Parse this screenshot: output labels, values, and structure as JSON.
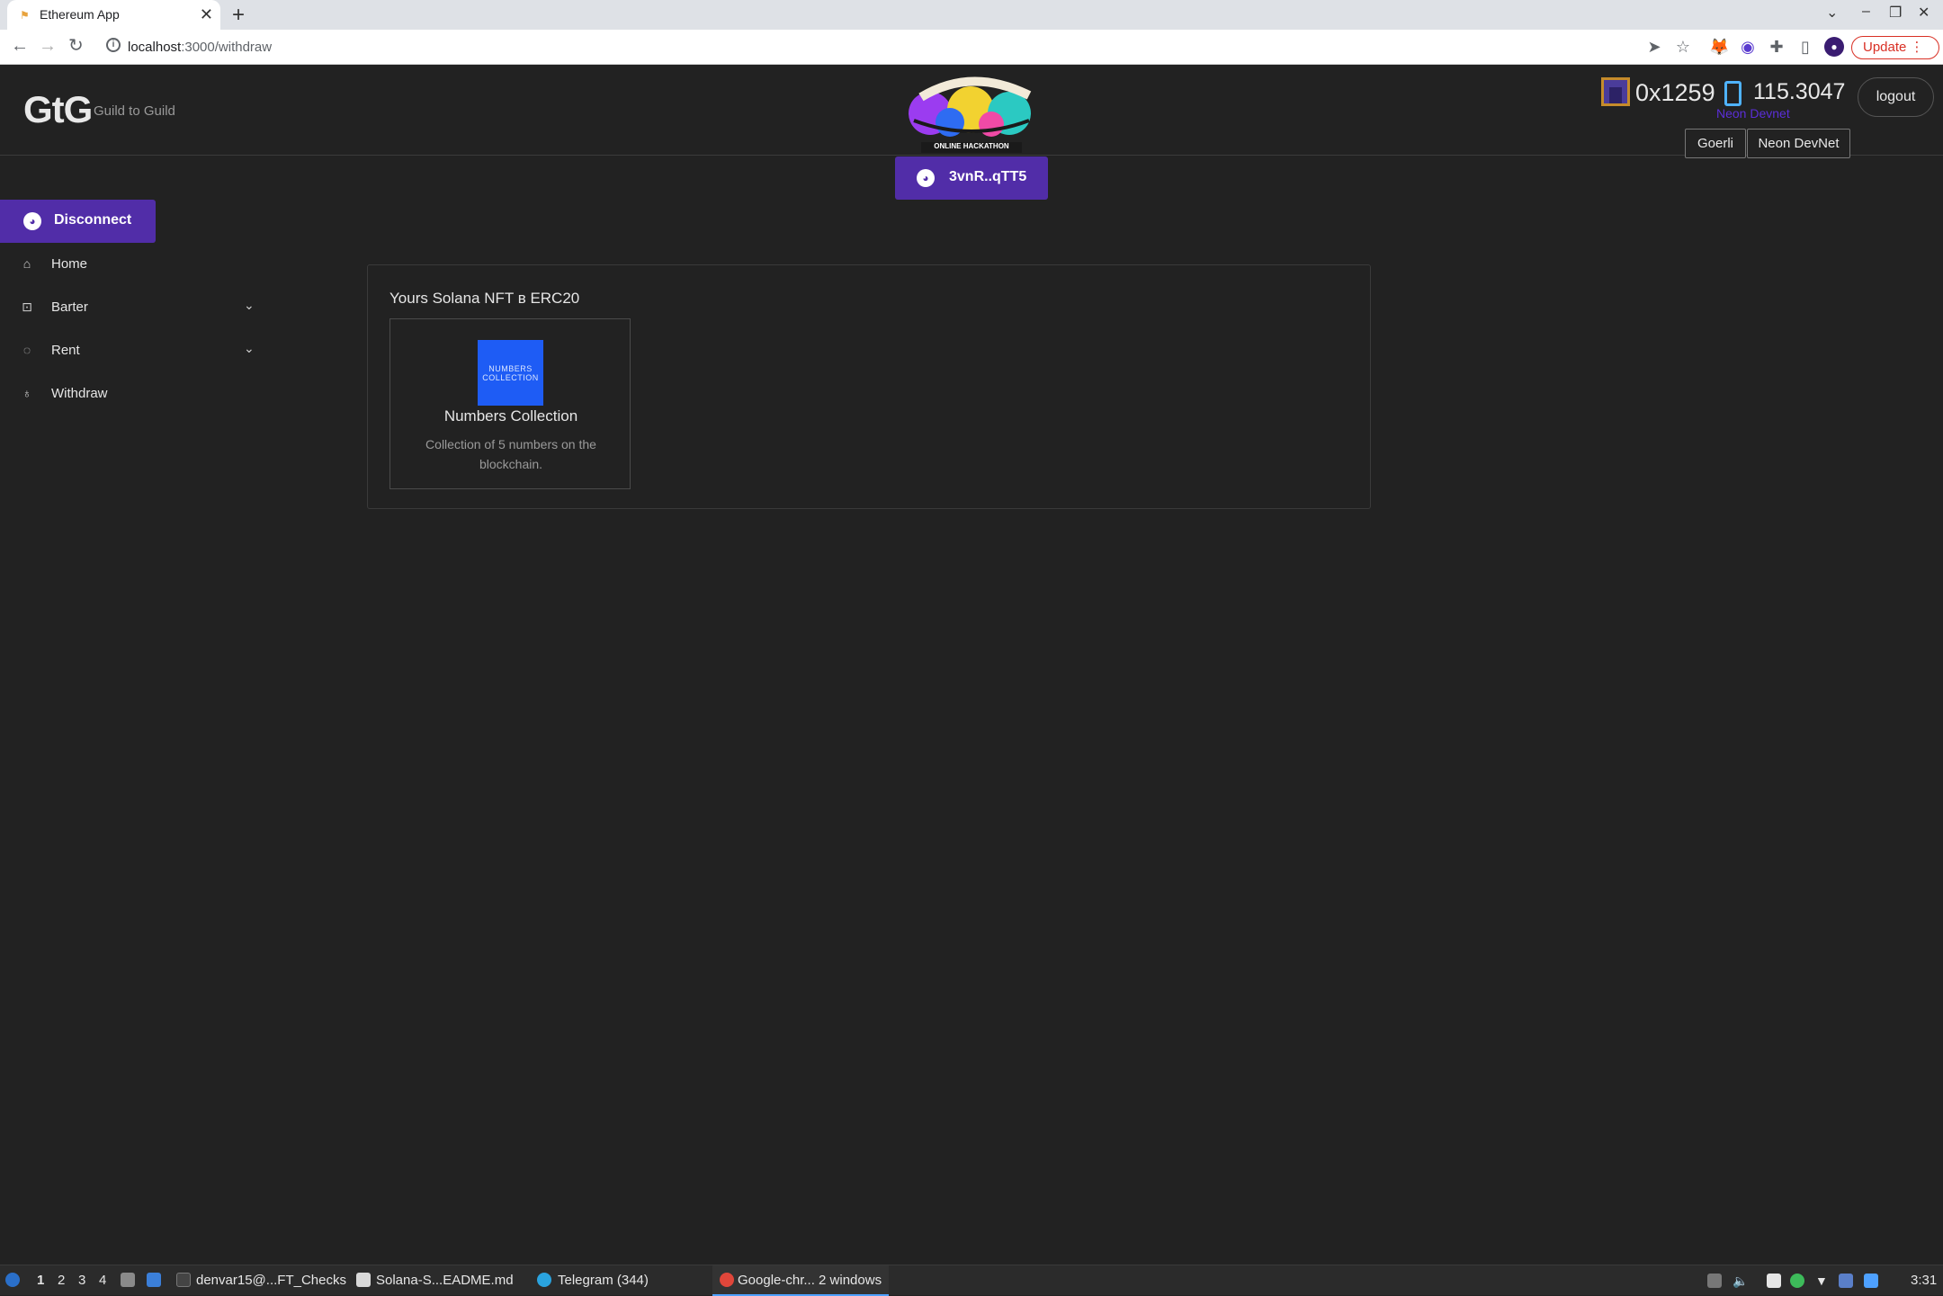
{
  "browser": {
    "tab_title": "Ethereum App",
    "url_host": "localhost",
    "url_path": ":3000/withdraw",
    "update_label": "Update",
    "new_tab_glyph": "+",
    "tab_close_glyph": "✕"
  },
  "header": {
    "logo": "GtG",
    "logo_sub": "Guild to Guild",
    "hackathon_logo_alt": "Summer Camp Online Hackathon",
    "wallet_button": "3vnR..qTT5",
    "account_address": "0x1259",
    "balance": "115.3047",
    "network_name": "Neon Devnet",
    "logout_label": "logout",
    "network_buttons": [
      "Goerli",
      "Neon DevNet"
    ]
  },
  "sidebar": {
    "disconnect_label": "Disconnect",
    "items": [
      {
        "label": "Home",
        "icon": "home-icon"
      },
      {
        "label": "Barter",
        "icon": "barter-icon"
      },
      {
        "label": "Rent",
        "icon": "rent-icon"
      },
      {
        "label": "Withdraw",
        "icon": "withdraw-icon"
      }
    ]
  },
  "main": {
    "panel_title": "Yours Solana NFT в ERC20",
    "nft": {
      "image_text": "NUMBERS COLLECTION",
      "name": "Numbers Collection",
      "description": "Collection of 5 numbers on the blockchain."
    }
  },
  "taskbar": {
    "workspaces": [
      "1",
      "2",
      "3",
      "4"
    ],
    "items": [
      "denvar15@...FT_Checks",
      "Solana-S...EADME.md",
      "Telegram (344)",
      "Google-chr... 2 windows"
    ],
    "clock": "3:31"
  },
  "colors": {
    "accent_purple": "#512da8",
    "background": "#222222",
    "nft_blue": "#1e5cf5"
  }
}
